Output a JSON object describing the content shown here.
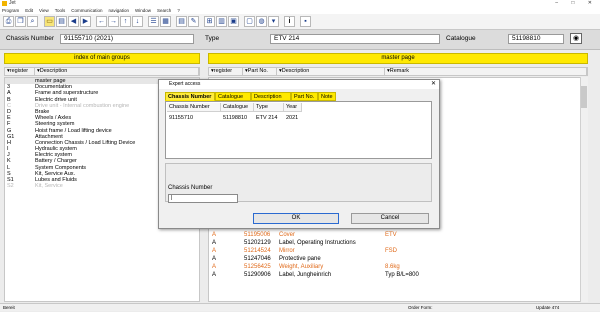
{
  "titlebar": {
    "title": "Jet",
    "buttons": "– □ ✕"
  },
  "menu": [
    "Program",
    "Edit",
    "View",
    "Tools",
    "Communication",
    "navigation",
    "Window",
    "Search",
    "?"
  ],
  "header": {
    "chassis_label": "Chassis Number",
    "chassis_value": "91155710  (2021)",
    "type_label": "Type",
    "type_value": "ETV 214",
    "catalogue_label": "Catalogue",
    "catalogue_value": "51198810"
  },
  "left_panel": {
    "title": "index of main groups",
    "col_register": "register",
    "col_description": "Description",
    "rows": [
      {
        "reg": "",
        "desc": "master page",
        "style": "sel"
      },
      {
        "reg": "3",
        "desc": "Documentation",
        "style": ""
      },
      {
        "reg": "A",
        "desc": "Frame and superstructure",
        "style": ""
      },
      {
        "reg": "B",
        "desc": "Electric drive unit",
        "style": ""
      },
      {
        "reg": "C",
        "desc": "Drive unit - Internal combustion engine",
        "style": "dim"
      },
      {
        "reg": "D",
        "desc": "Brake",
        "style": ""
      },
      {
        "reg": "E",
        "desc": "Wheels / Axles",
        "style": ""
      },
      {
        "reg": "F",
        "desc": "Steering system",
        "style": ""
      },
      {
        "reg": "G",
        "desc": "Hoist frame / Load lifting device",
        "style": ""
      },
      {
        "reg": "G1",
        "desc": "Attachment",
        "style": ""
      },
      {
        "reg": "H",
        "desc": "Connection Chassis / Load Lifting Device",
        "style": ""
      },
      {
        "reg": "I",
        "desc": "Hydraulic system",
        "style": ""
      },
      {
        "reg": "J",
        "desc": "Electric system",
        "style": ""
      },
      {
        "reg": "K",
        "desc": "Battery / Charger",
        "style": ""
      },
      {
        "reg": "L",
        "desc": "System Components",
        "style": ""
      },
      {
        "reg": "S",
        "desc": "Kit, Service Aux.",
        "style": ""
      },
      {
        "reg": "S1",
        "desc": "Lubes and Fluids",
        "style": ""
      },
      {
        "reg": "S2",
        "desc": "Kit, Service",
        "style": "dim"
      }
    ]
  },
  "right_panel": {
    "title": "master page",
    "col_register": "register",
    "col_part": "Part No.",
    "col_description": "Description",
    "col_remark": "Remark",
    "partial_remark": "",
    "rows": [
      {
        "reg": "A",
        "part": "51195006",
        "desc": "Cover",
        "remark": "ETV",
        "style": "orange"
      },
      {
        "reg": "A",
        "part": "51202129",
        "desc": "Label, Operating Instructions",
        "remark": "",
        "style": ""
      },
      {
        "reg": "A",
        "part": "51214524",
        "desc": "Mirror",
        "remark": "FSD",
        "style": "orange"
      },
      {
        "reg": "A",
        "part": "51247046",
        "desc": "Protective pane",
        "remark": "",
        "style": ""
      },
      {
        "reg": "A",
        "part": "51256425",
        "desc": "Weight, Auxiliary",
        "remark": "8.6kg",
        "style": "orange"
      },
      {
        "reg": "A",
        "part": "51290906",
        "desc": "Label, Jungheinrich",
        "remark": "Typ B/L=800",
        "style": ""
      }
    ]
  },
  "dialog": {
    "title": "Expert access",
    "close": "✕",
    "tabs": [
      "Chassis Number",
      "Catalogue",
      "Description",
      "Part No.",
      "Note"
    ],
    "headers": [
      "Chassis Number",
      "Catalogue",
      "Type",
      "Year"
    ],
    "row": [
      "91155710",
      "51198810",
      "ETV 214",
      "2021"
    ],
    "group_label": "Chassis Number",
    "input_value": "|",
    "ok": "OK",
    "cancel": "Cancel"
  },
  "status": {
    "left": "Bereit",
    "mid": "Order Form:",
    "right": "Update 474"
  }
}
